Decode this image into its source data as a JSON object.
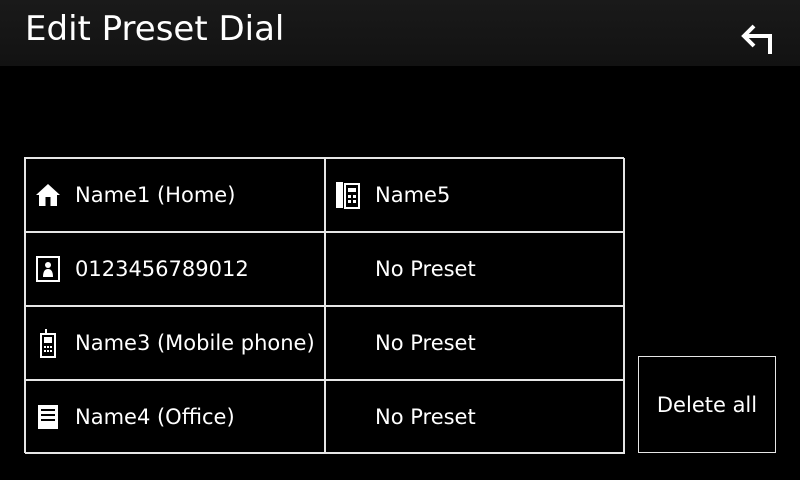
{
  "header": {
    "title": "Edit Preset Dial",
    "back_icon": "return-arrow-icon"
  },
  "presets": [
    {
      "label": "Name1 (Home)",
      "icon": "home-icon"
    },
    {
      "label": "Name5",
      "icon": "fax-icon"
    },
    {
      "label": "0123456789012",
      "icon": "contact-icon"
    },
    {
      "label": "No Preset",
      "icon": ""
    },
    {
      "label": "Name3 (Mobile phone)",
      "icon": "mobile-phone-icon"
    },
    {
      "label": "No Preset",
      "icon": ""
    },
    {
      "label": "Name4 (Office)",
      "icon": "office-icon"
    },
    {
      "label": "No Preset",
      "icon": ""
    }
  ],
  "actions": {
    "delete_all_label": "Delete all"
  },
  "colors": {
    "background": "#000000",
    "text": "#ffffff",
    "border": "#e6e6e6"
  }
}
